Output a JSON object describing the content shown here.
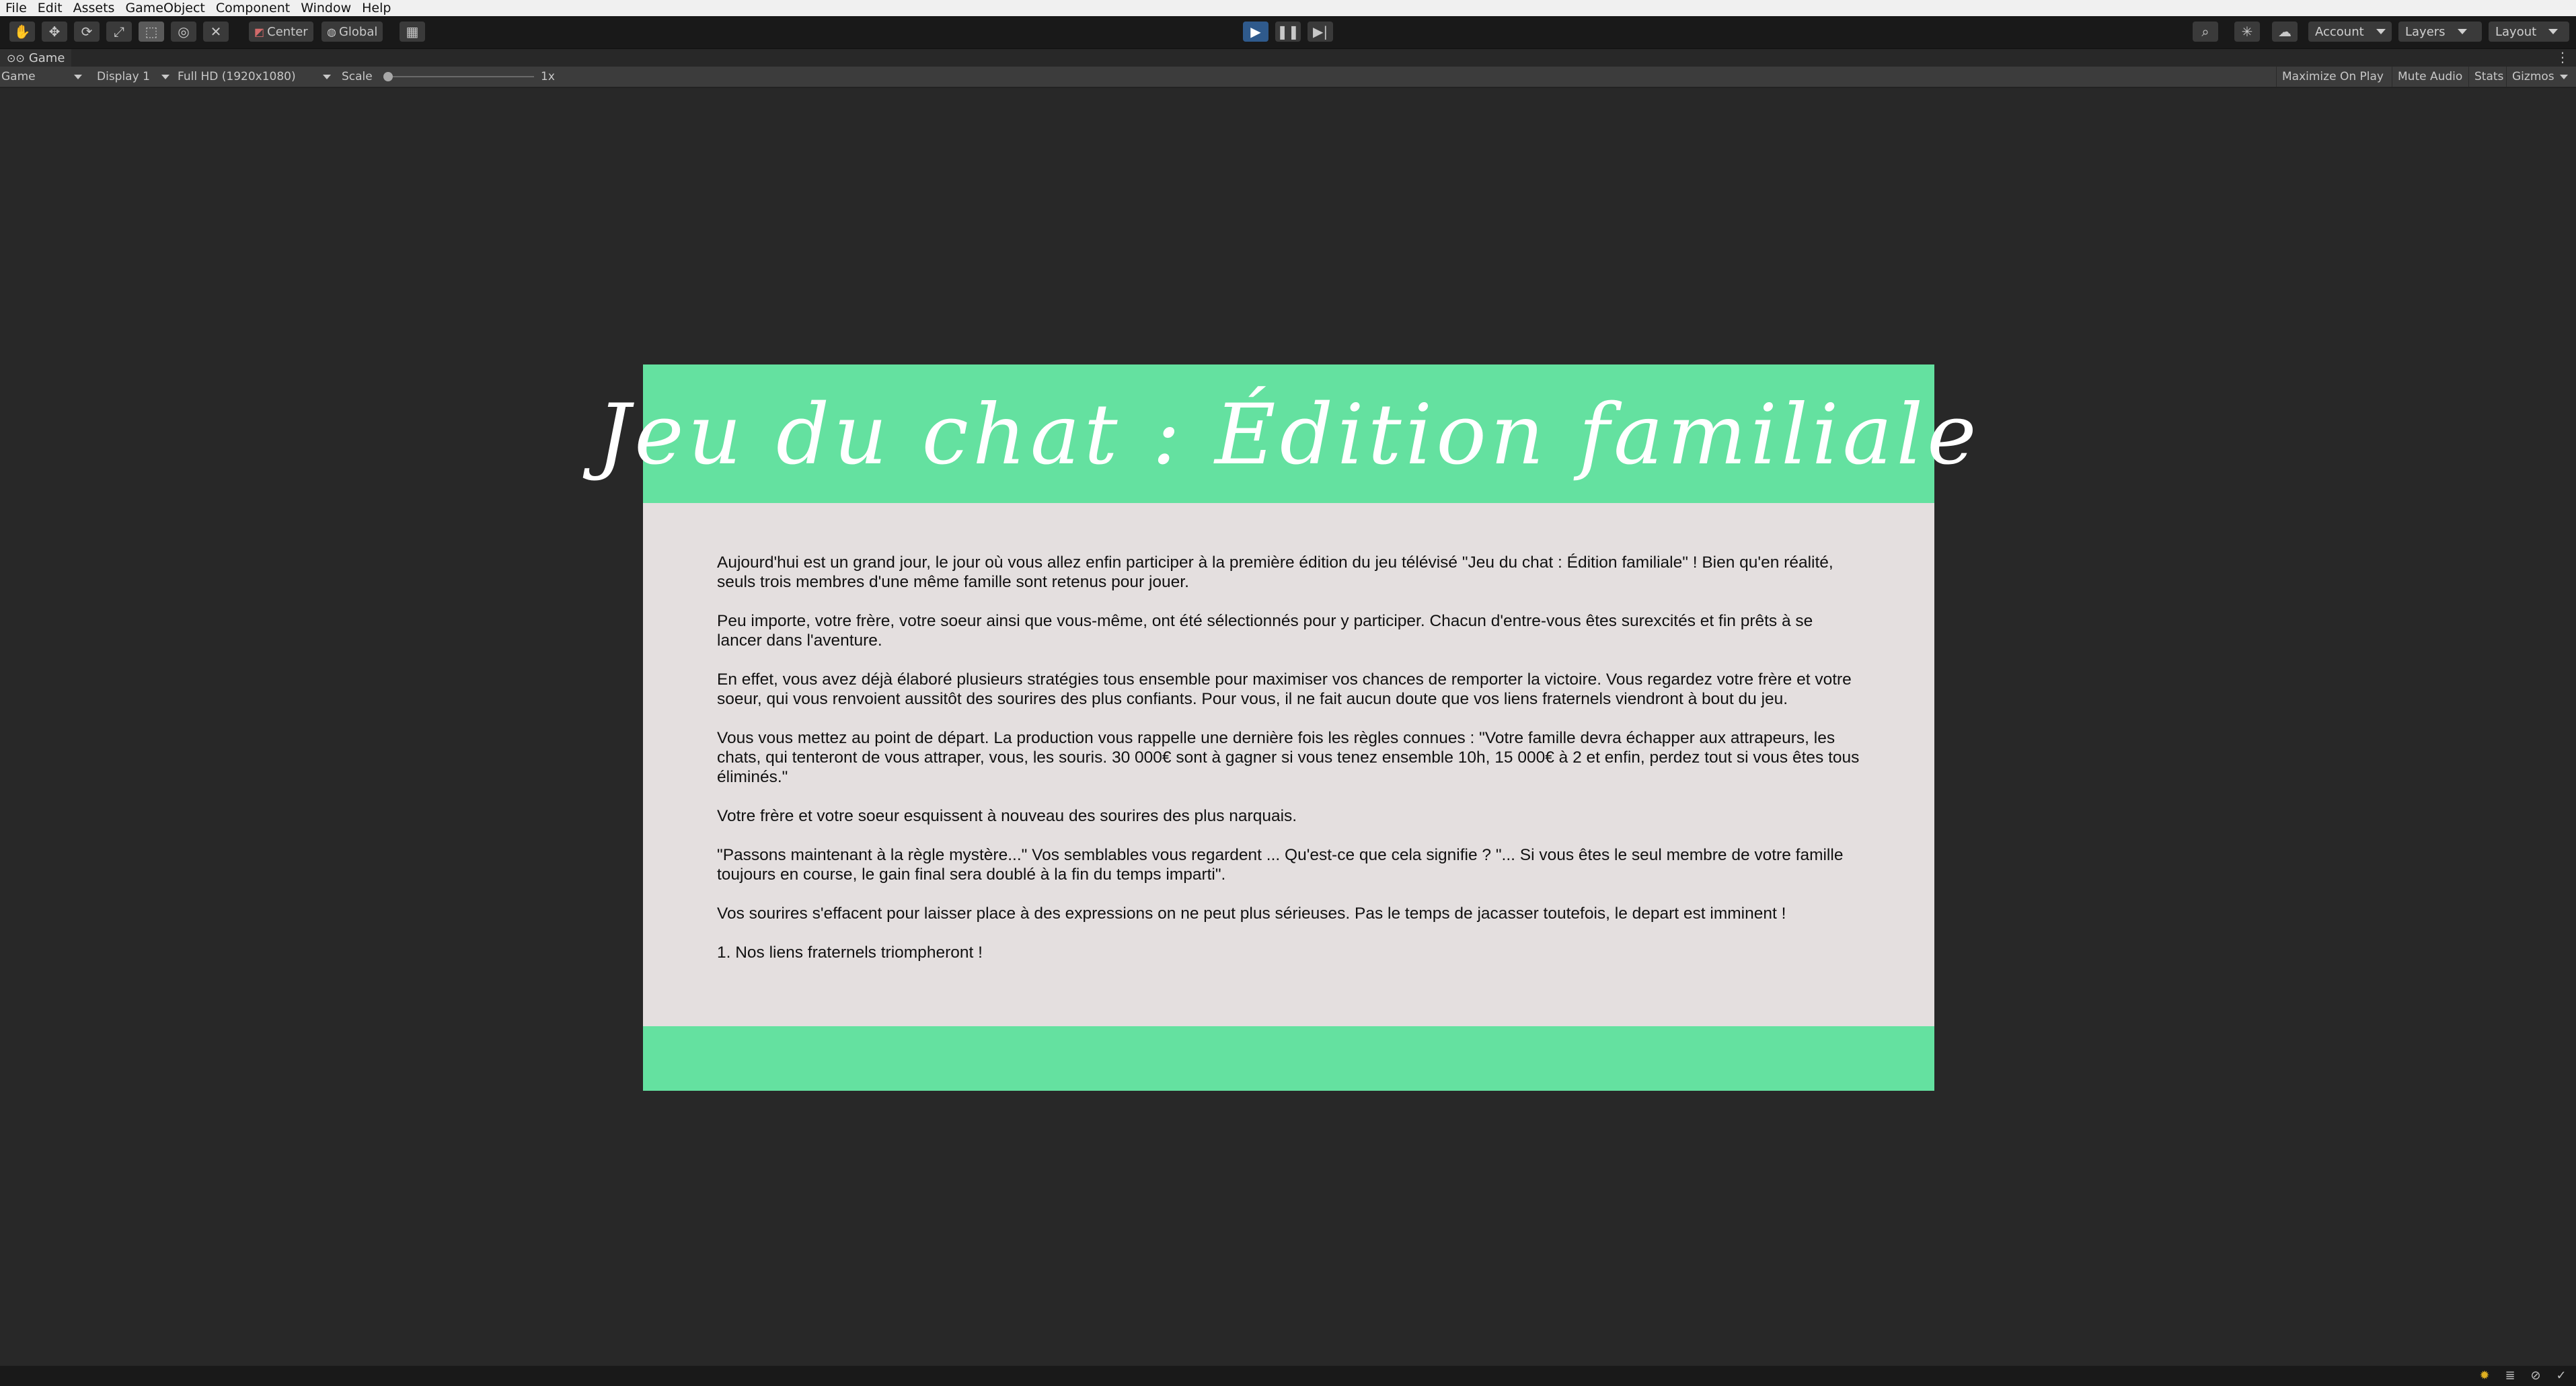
{
  "menubar": {
    "items": [
      "File",
      "Edit",
      "Assets",
      "GameObject",
      "Component",
      "Window",
      "Help"
    ]
  },
  "toolbar": {
    "pivot_label": "Center",
    "space_label": "Global",
    "account_label": "Account",
    "layers_label": "Layers",
    "layout_label": "Layout"
  },
  "tab": {
    "label": "Game"
  },
  "gamebar": {
    "view_select": "Game",
    "display_select": "Display 1",
    "resolution_select": "Full HD (1920x1080)",
    "scale_label": "Scale",
    "scale_value": "1x",
    "maximize_on_play": "Maximize On Play",
    "mute_audio": "Mute Audio",
    "stats": "Stats",
    "gizmos": "Gizmos"
  },
  "game": {
    "title": "Jeu du chat : Édition familiale",
    "paragraphs": [
      "Aujourd'hui est un grand jour, le jour où vous allez enfin participer à la première édition du jeu télévisé \"Jeu du chat : Édition familiale\" ! Bien qu'en réalité, seuls trois membres d'une même famille sont retenus pour jouer.",
      "Peu importe, votre frère, votre soeur ainsi que vous-même, ont été sélectionnés pour y participer. Chacun d'entre-vous êtes surexcités et fin prêts à se lancer dans l'aventure.",
      "En effet, vous avez déjà élaboré plusieurs stratégies tous ensemble pour maximiser vos chances de remporter la victoire. Vous regardez votre frère et votre soeur, qui vous renvoient aussitôt des sourires des plus confiants. Pour vous, il ne fait aucun doute que vos liens fraternels viendront à bout du jeu.",
      "Vous vous mettez au point de départ. La production vous rappelle une dernière fois les règles connues : \"Votre famille devra échapper aux attrapeurs, les chats, qui tenteront de vous attraper, vous, les souris. 30 000€ sont à gagner si vous tenez ensemble 10h, 15 000€ à 2 et enfin, perdez tout si vous êtes tous éliminés.\"",
      "Votre frère et votre soeur esquissent à nouveau des sourires des plus narquais.",
      "\"Passons maintenant à la règle mystère...\" Vos semblables vous regardent ... Qu'est-ce que cela signifie ? \"... Si vous êtes le seul membre de votre famille toujours en course, le gain final sera doublé à la fin du temps imparti\".",
      "Vos sourires s'effacent pour laisser place à des expressions on ne peut plus sérieuses. Pas le temps de jacasser toutefois, le depart est imminent !"
    ],
    "choice": "1. Nos liens fraternels triompheront !"
  },
  "colors": {
    "header_green": "#64e1a0",
    "panel_bg": "#e4dfdf",
    "editor_bg": "#282828",
    "play_active": "#2f5a8c"
  }
}
